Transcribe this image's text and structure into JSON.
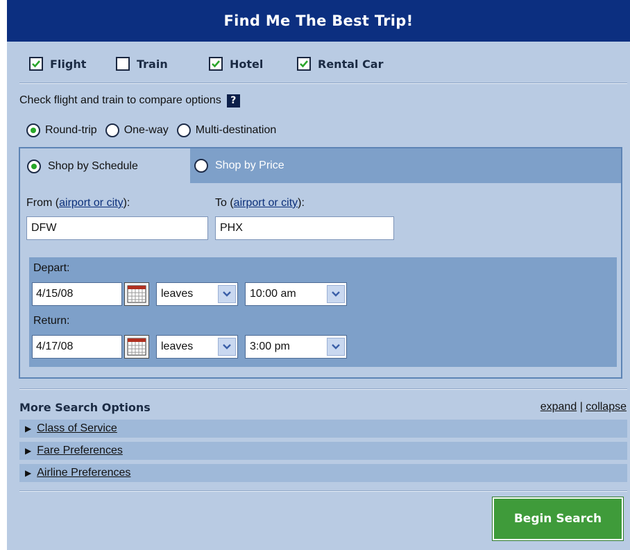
{
  "header": {
    "title": "Find Me The Best Trip!"
  },
  "modes": [
    {
      "label": "Flight",
      "checked": true
    },
    {
      "label": "Train",
      "checked": false
    },
    {
      "label": "Hotel",
      "checked": true
    },
    {
      "label": "Rental Car",
      "checked": true
    }
  ],
  "compare": {
    "text": "Check flight and train to compare options",
    "help_label": "?"
  },
  "trip_type": {
    "options": [
      {
        "label": "Round-trip",
        "selected": true
      },
      {
        "label": "One-way",
        "selected": false
      },
      {
        "label": "Multi-destination",
        "selected": false
      }
    ]
  },
  "shop_tabs": [
    {
      "label": "Shop by Schedule",
      "selected": true
    },
    {
      "label": "Shop by Price",
      "selected": false
    }
  ],
  "from": {
    "label_prefix": "From (",
    "link": "airport or city",
    "label_suffix": "):",
    "value": "DFW"
  },
  "to": {
    "label_prefix": "To (",
    "link": "airport or city",
    "label_suffix": "):",
    "value": "PHX"
  },
  "depart": {
    "label": "Depart:",
    "date": "4/15/08",
    "mode": "leaves",
    "time": "10:00 am"
  },
  "return": {
    "label": "Return:",
    "date": "4/17/08",
    "mode": "leaves",
    "time": "3:00 pm"
  },
  "more_options": {
    "title": "More Search Options",
    "expand": "expand",
    "separator": "|",
    "collapse": "collapse",
    "items": [
      "Class of Service",
      "Fare Preferences",
      "Airline Preferences"
    ]
  },
  "search_button": {
    "label": "Begin Search"
  },
  "colors": {
    "header_bg": "#0c2f80",
    "panel_bg": "#b9cbe3",
    "accent_bg": "#7ea0c9",
    "button_bg": "#3f9b3a",
    "radio_dot": "#28a828"
  },
  "icons": {
    "checkbox_checked": "checkmark-icon",
    "help": "help-icon",
    "calendar": "calendar-icon",
    "dropdown": "chevron-down-icon",
    "expander": "triangle-right-icon"
  }
}
